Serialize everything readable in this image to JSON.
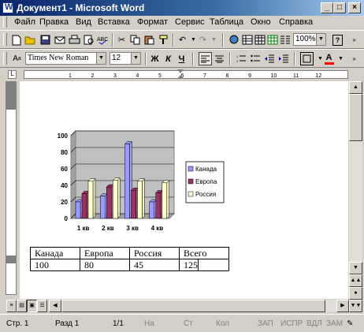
{
  "window": {
    "title": "Документ1 - Microsoft Word"
  },
  "menu": [
    "Файл",
    "Правка",
    "Вид",
    "Вставка",
    "Формат",
    "Сервис",
    "Таблица",
    "Окно",
    "Справка"
  ],
  "toolbar": {
    "zoom": "100%",
    "help": "?"
  },
  "formatting": {
    "font": "Times New Roman",
    "size": "12",
    "bold": "Ж",
    "italic": "К",
    "underline": "Ч",
    "font_color_letter": "A"
  },
  "ruler": {
    "numbers": [
      "1",
      "2",
      "3",
      "4",
      "5",
      "6",
      "7",
      "8",
      "9",
      "10",
      "11",
      "12"
    ]
  },
  "chart_data": {
    "type": "bar",
    "categories": [
      "1 кв",
      "2 кв",
      "3 кв",
      "4 кв"
    ],
    "series": [
      {
        "name": "Канада",
        "values": [
          20,
          27,
          90,
          20
        ],
        "color": "#9999ff"
      },
      {
        "name": "Европа",
        "values": [
          30,
          38,
          34,
          31
        ],
        "color": "#993366"
      },
      {
        "name": "Россия",
        "values": [
          45,
          46,
          45,
          43
        ],
        "color": "#ffffcc"
      }
    ],
    "yticks": [
      "0",
      "20",
      "40",
      "60",
      "80",
      "100"
    ],
    "ylim": [
      0,
      100
    ],
    "legend_position": "right",
    "grid": true
  },
  "table": {
    "headers": [
      "Канада",
      "Европа",
      "Россия",
      "Всего"
    ],
    "values": [
      "100",
      "80",
      "45",
      "125"
    ]
  },
  "statusbar": {
    "page": "Стр. 1",
    "section": "Разд 1",
    "pages": "1/1",
    "at": "На",
    "line": "Ст",
    "col": "Кол",
    "rec": "ЗАП",
    "trk": "ИСПР",
    "ext": "ВДЛ",
    "ovr": "ЗАМ"
  }
}
